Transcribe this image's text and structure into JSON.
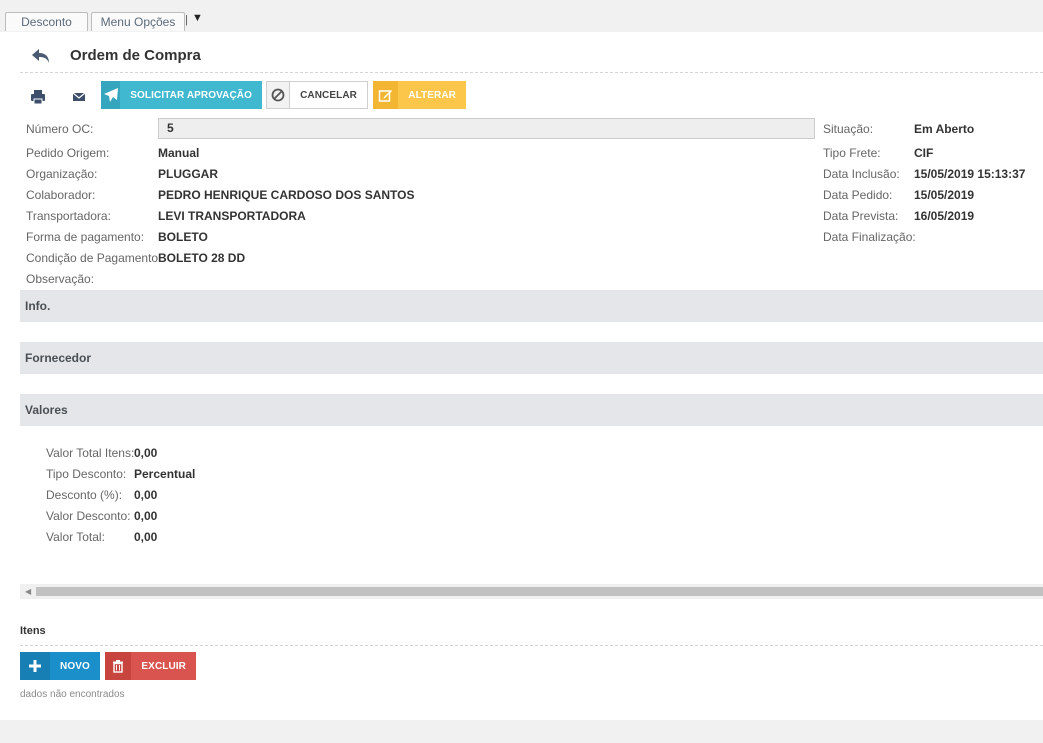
{
  "tabs": [
    {
      "label": "Desconto"
    },
    {
      "label": "Menu Opções"
    }
  ],
  "tab_separator": "|",
  "tab_dropdown": "▼",
  "header": {
    "title": "Ordem de Compra",
    "back_icon": "back-arrow-icon"
  },
  "toolbar": {
    "print_icon": "printer-icon",
    "email_icon": "envelope-icon",
    "solicitar": {
      "label": "SOLICITAR APROVAÇÃO",
      "icon": "paper-plane-icon",
      "color": "#3fb8d0"
    },
    "cancelar": {
      "label": "CANCELAR",
      "icon": "ban-icon"
    },
    "alterar": {
      "label": "ALTERAR",
      "icon": "edit-icon",
      "color": "#fcc64a"
    }
  },
  "form": {
    "numero_oc": {
      "label": "Número OC:",
      "value": "5"
    },
    "left": [
      {
        "label": "Pedido Origem:",
        "value": "Manual"
      },
      {
        "label": "Organização:",
        "value": "PLUGGAR"
      },
      {
        "label": "Colaborador:",
        "value": "PEDRO HENRIQUE CARDOSO DOS SANTOS"
      },
      {
        "label": "Transportadora:",
        "value": "LEVI TRANSPORTADORA"
      },
      {
        "label": "Forma de pagamento:",
        "value": "BOLETO"
      },
      {
        "label": "Condição de Pagamento:",
        "value": "BOLETO 28 DD"
      },
      {
        "label": "Observação:",
        "value": ""
      }
    ],
    "right": [
      {
        "label": "Situação:",
        "value": "Em Aberto"
      },
      {
        "label": "Tipo Frete:",
        "value": "CIF"
      },
      {
        "label": "Data Inclusão:",
        "value": "15/05/2019 15:13:37"
      },
      {
        "label": "Data Pedido:",
        "value": "15/05/2019"
      },
      {
        "label": "Data Prevista:",
        "value": "16/05/2019"
      },
      {
        "label": "Data Finalização:",
        "value": ""
      }
    ]
  },
  "sections": [
    {
      "label": "Info."
    },
    {
      "label": "Fornecedor"
    },
    {
      "label": "Valores"
    }
  ],
  "valores": [
    {
      "label": "Valor Total Itens:",
      "value": "0,00"
    },
    {
      "label": "Tipo Desconto:",
      "value": "Percentual"
    },
    {
      "label": "Desconto (%):",
      "value": "0,00"
    },
    {
      "label": "Valor Desconto:",
      "value": "0,00"
    },
    {
      "label": "Valor Total:",
      "value": "0,00"
    }
  ],
  "itens": {
    "title": "Itens",
    "novo": {
      "label": "NOVO",
      "icon": "plus-icon",
      "color": "#1b8fc9"
    },
    "excluir": {
      "label": "EXCLUIR",
      "icon": "trash-icon",
      "color": "#d9534f"
    },
    "empty_message": "dados não encontrados"
  }
}
